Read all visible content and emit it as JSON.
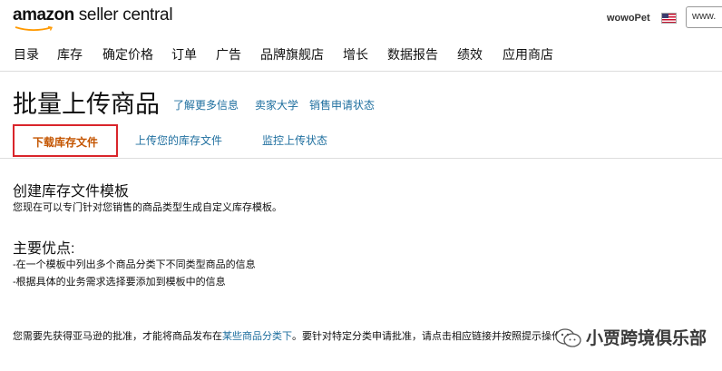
{
  "header": {
    "logo_brand": "amazon",
    "logo_product": " seller central",
    "store_name": "wowoPet",
    "flag_icon": "us-flag-icon",
    "search_value": "www."
  },
  "nav": [
    "目录",
    "库存",
    "确定价格",
    "订单",
    "广告",
    "品牌旗舰店",
    "增长",
    "数据报告",
    "绩效",
    "应用商店"
  ],
  "page": {
    "title": "批量上传商品",
    "links": [
      "了解更多信息",
      "卖家大学",
      "销售申请状态"
    ]
  },
  "tabs": [
    {
      "label": "下载库存文件",
      "active": true
    },
    {
      "label": "上传您的库存文件",
      "active": false
    },
    {
      "label": "监控上传状态",
      "active": false
    }
  ],
  "content": {
    "section1_title": "创建库存文件模板",
    "section1_text": "您现在可以专门针对您销售的商品类型生成自定义库存模板。",
    "section2_title": "主要优点:",
    "benefits": [
      "-在一个模板中列出多个商品分类下不同类型商品的信息",
      "-根据具体的业务需求选择要添加到模板中的信息"
    ],
    "note_before": "您需要先获得亚马逊的批准，才能将商品发布在",
    "note_link": "某些商品分类下",
    "note_after": "。要针对特定分类申请批准，请点击相应链接并按照提示操作。"
  },
  "watermark": {
    "text": "小贾跨境俱乐部",
    "icon": "wechat-icon"
  },
  "colors": {
    "link": "#1f6f9f",
    "active_tab_text": "#c45500",
    "active_tab_border": "#d9252b",
    "logo_smile": "#f90"
  }
}
